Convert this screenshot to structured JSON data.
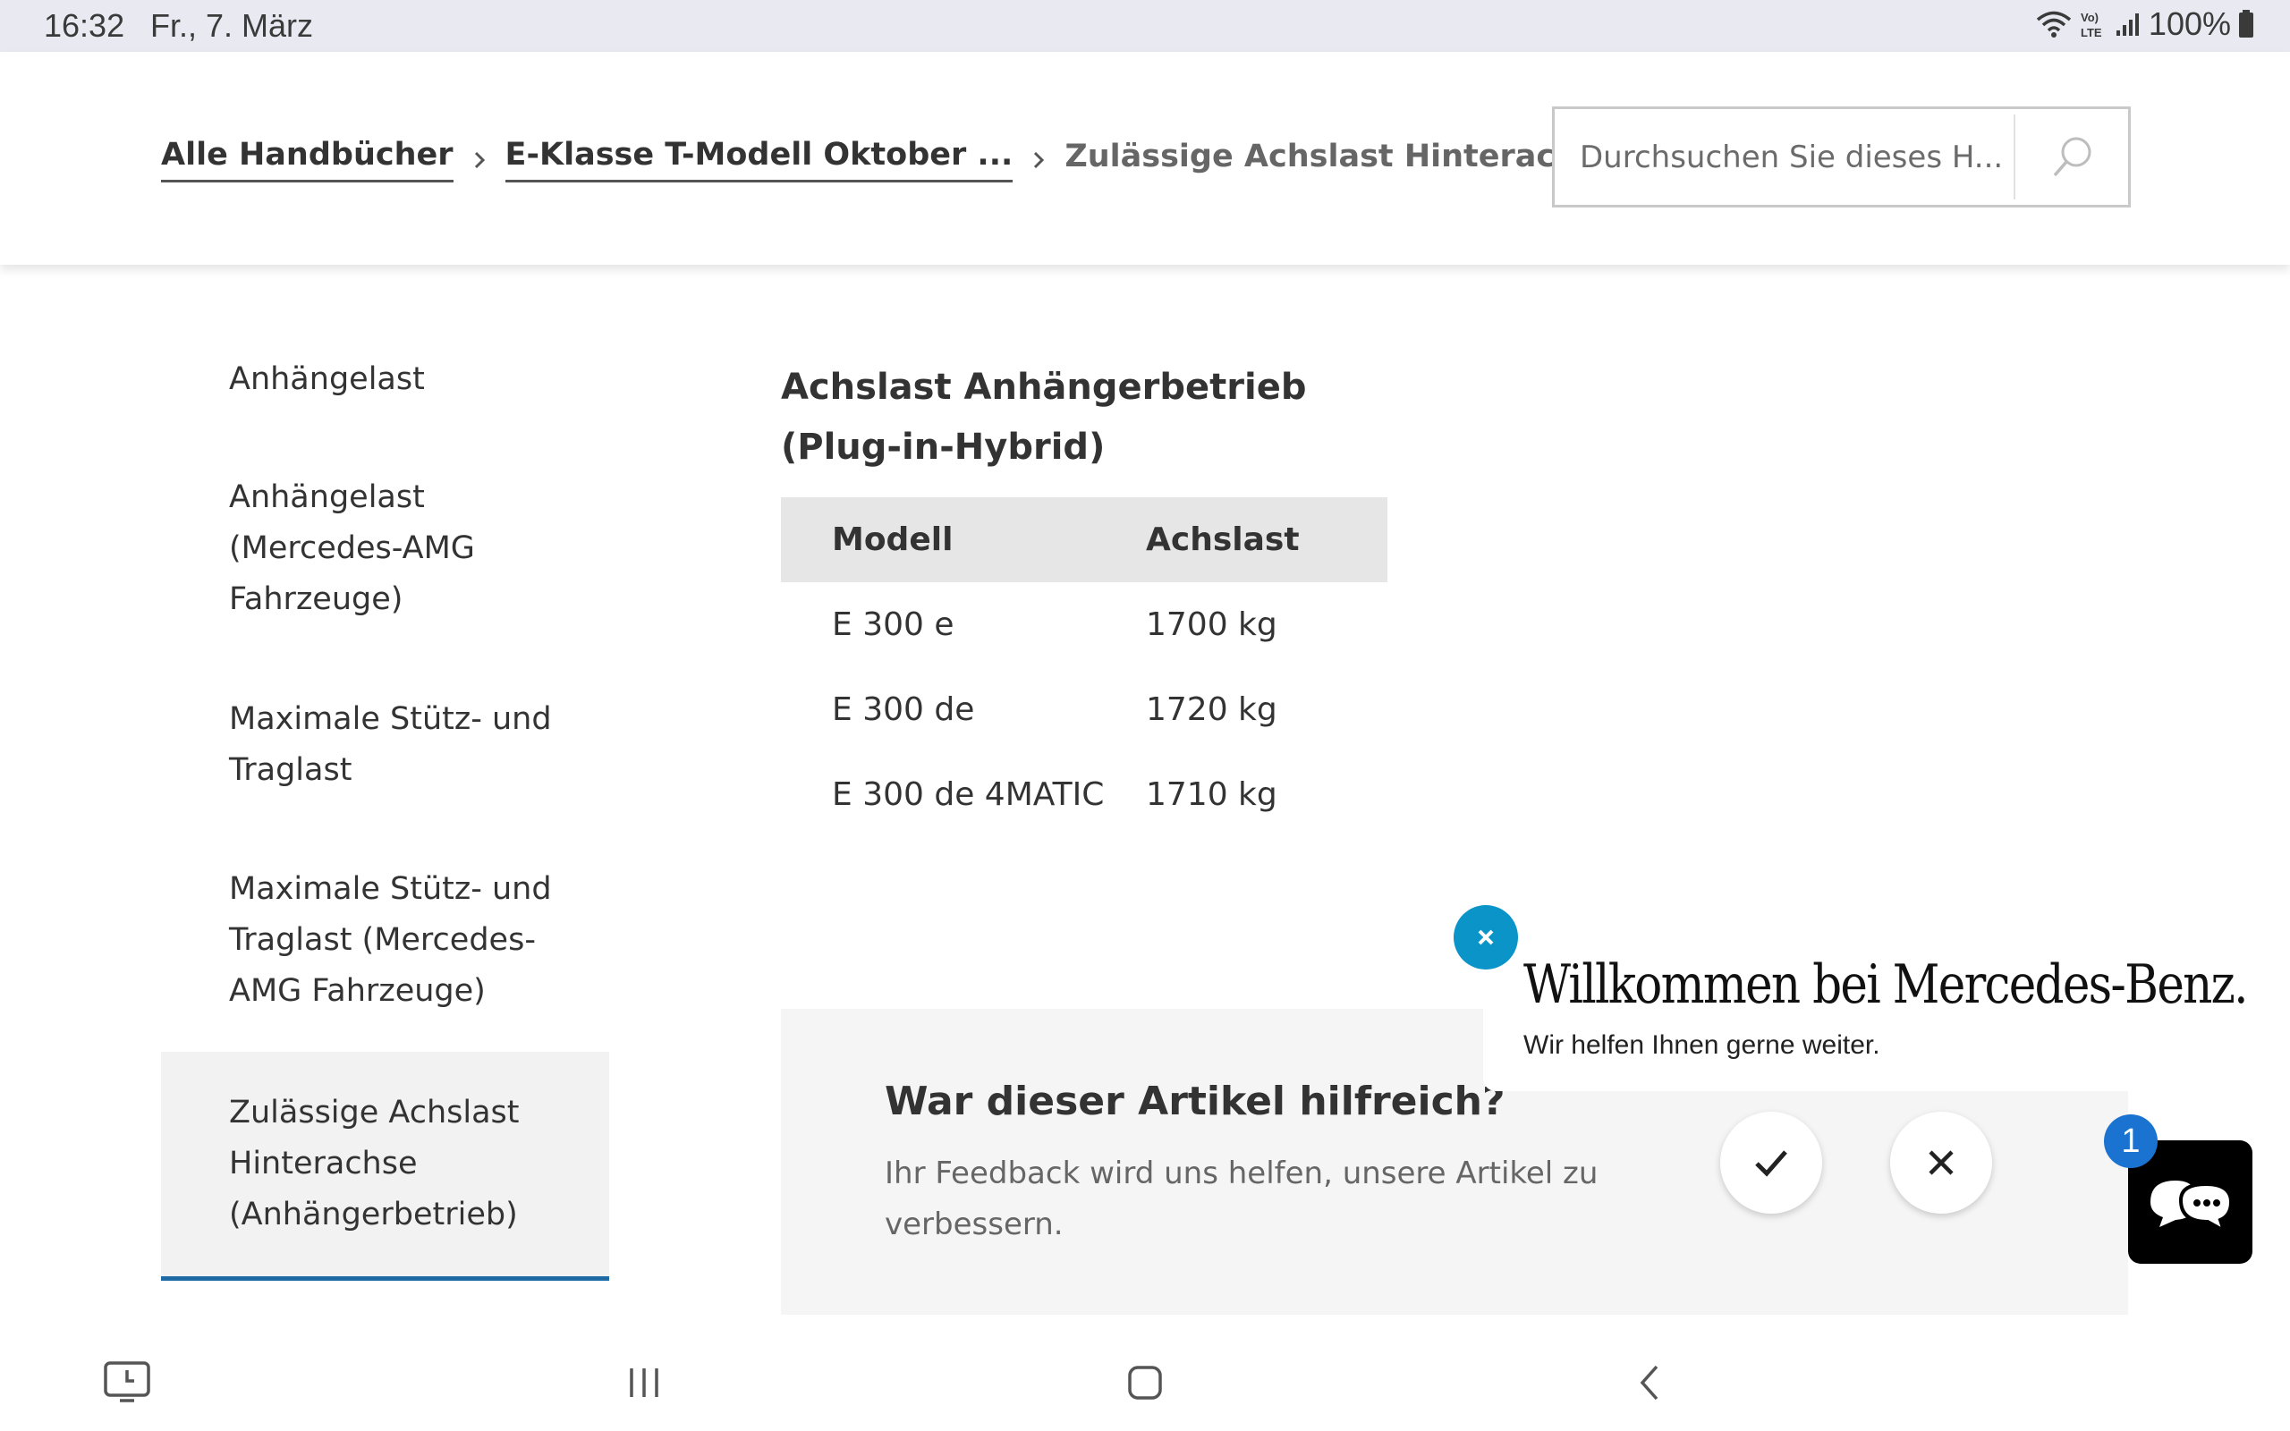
{
  "status_bar": {
    "time": "16:32",
    "date": "Fr., 7. März",
    "battery": "100%"
  },
  "breadcrumbs": {
    "items": [
      {
        "label": "Alle Handbücher"
      },
      {
        "label": "E-Klasse T-Modell Oktober ..."
      },
      {
        "label": "Zulässige Achslast Hinterachse ..."
      }
    ]
  },
  "search": {
    "placeholder": "Durchsuchen Sie dieses H..."
  },
  "sidebar": {
    "items": [
      {
        "label": "Anhängelast"
      },
      {
        "label": "Anhängelast (Mercedes-AMG Fahrzeuge)"
      },
      {
        "label": "Maximale Stütz- und Traglast"
      },
      {
        "label": "Maximale Stütz- und Traglast (Mercedes-AMG Fahrzeuge)"
      },
      {
        "label": "Zulässige Achslast Hinterachse (Anhängerbetrieb)"
      }
    ]
  },
  "section": {
    "title": "Achslast Anhängerbetrieb (Plug-in-Hybrid)"
  },
  "table": {
    "headers": [
      "Modell",
      "Achslast"
    ],
    "rows": [
      [
        "E 300 e",
        "1700 kg"
      ],
      [
        "E 300 de",
        "1720 kg"
      ],
      [
        "E 300 de 4MATIC",
        "1710 kg"
      ]
    ]
  },
  "feedback": {
    "title": "War dieser Artikel hilfreich?",
    "text": "Ihr Feedback wird uns helfen, unsere Artikel zu verbessern."
  },
  "chat": {
    "welcome": "Willkommen bei Mercedes-Benz.",
    "subtitle": "Wir helfen Ihnen gerne weiter.",
    "badge": "1"
  },
  "colors": {
    "accent": "#1d6aa5",
    "chat_close": "#0a94c8",
    "badge": "#1a73d1"
  }
}
